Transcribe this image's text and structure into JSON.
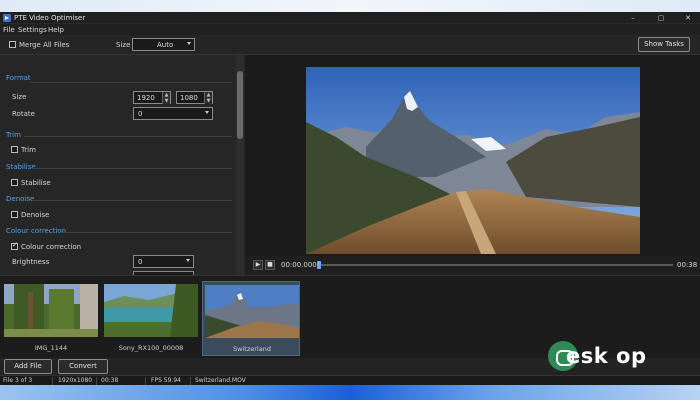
{
  "window": {
    "title": "PTE Video Optimiser",
    "controls": [
      "–",
      "▢",
      "✕"
    ]
  },
  "menu": [
    "File",
    "Settings",
    "Help"
  ],
  "toolbar": {
    "merge_label": "Merge All Files",
    "merge_checked": false,
    "size_label": "Size",
    "size_value": "Auto",
    "show_tasks_label": "Show Tasks"
  },
  "settings": {
    "format": {
      "title": "Format",
      "size_label": "Size",
      "width": "1920",
      "height": "1080",
      "rotate_label": "Rotate",
      "rotate_value": "0"
    },
    "trim": {
      "title": "Trim",
      "checkbox_label": "Trim",
      "checked": false
    },
    "stabilise": {
      "title": "Stabilise",
      "checkbox_label": "Stabilise",
      "checked": false
    },
    "denoise": {
      "title": "Denoise",
      "checkbox_label": "Denoise",
      "checked": false
    },
    "colour": {
      "title": "Colour correction",
      "checkbox_label": "Colour correction",
      "checked": true,
      "brightness_label": "Brightness",
      "brightness_value": "0"
    }
  },
  "player": {
    "current_time": "00:00.000",
    "end_time": "00:38",
    "play_icon": "play-icon",
    "stop_icon": "stop-icon"
  },
  "files": [
    {
      "name": "IMG_1144",
      "selected": false
    },
    {
      "name": "Sony_RX100_00008",
      "selected": false
    },
    {
      "name": "Switzerland",
      "selected": true
    }
  ],
  "buttons": {
    "add_file": "Add File",
    "convert": "Convert"
  },
  "status": {
    "file_count": "File 3 of 3",
    "resolution": "1920x1080",
    "duration": "00:38",
    "fps": "FPS 59.94",
    "filename": "Switzerland.MOV"
  },
  "watermark": "esk op",
  "colors": {
    "accent": "#5aa0e8",
    "background": "#1f1f1f",
    "panel": "#262626",
    "selected": "#3b4b5e"
  }
}
